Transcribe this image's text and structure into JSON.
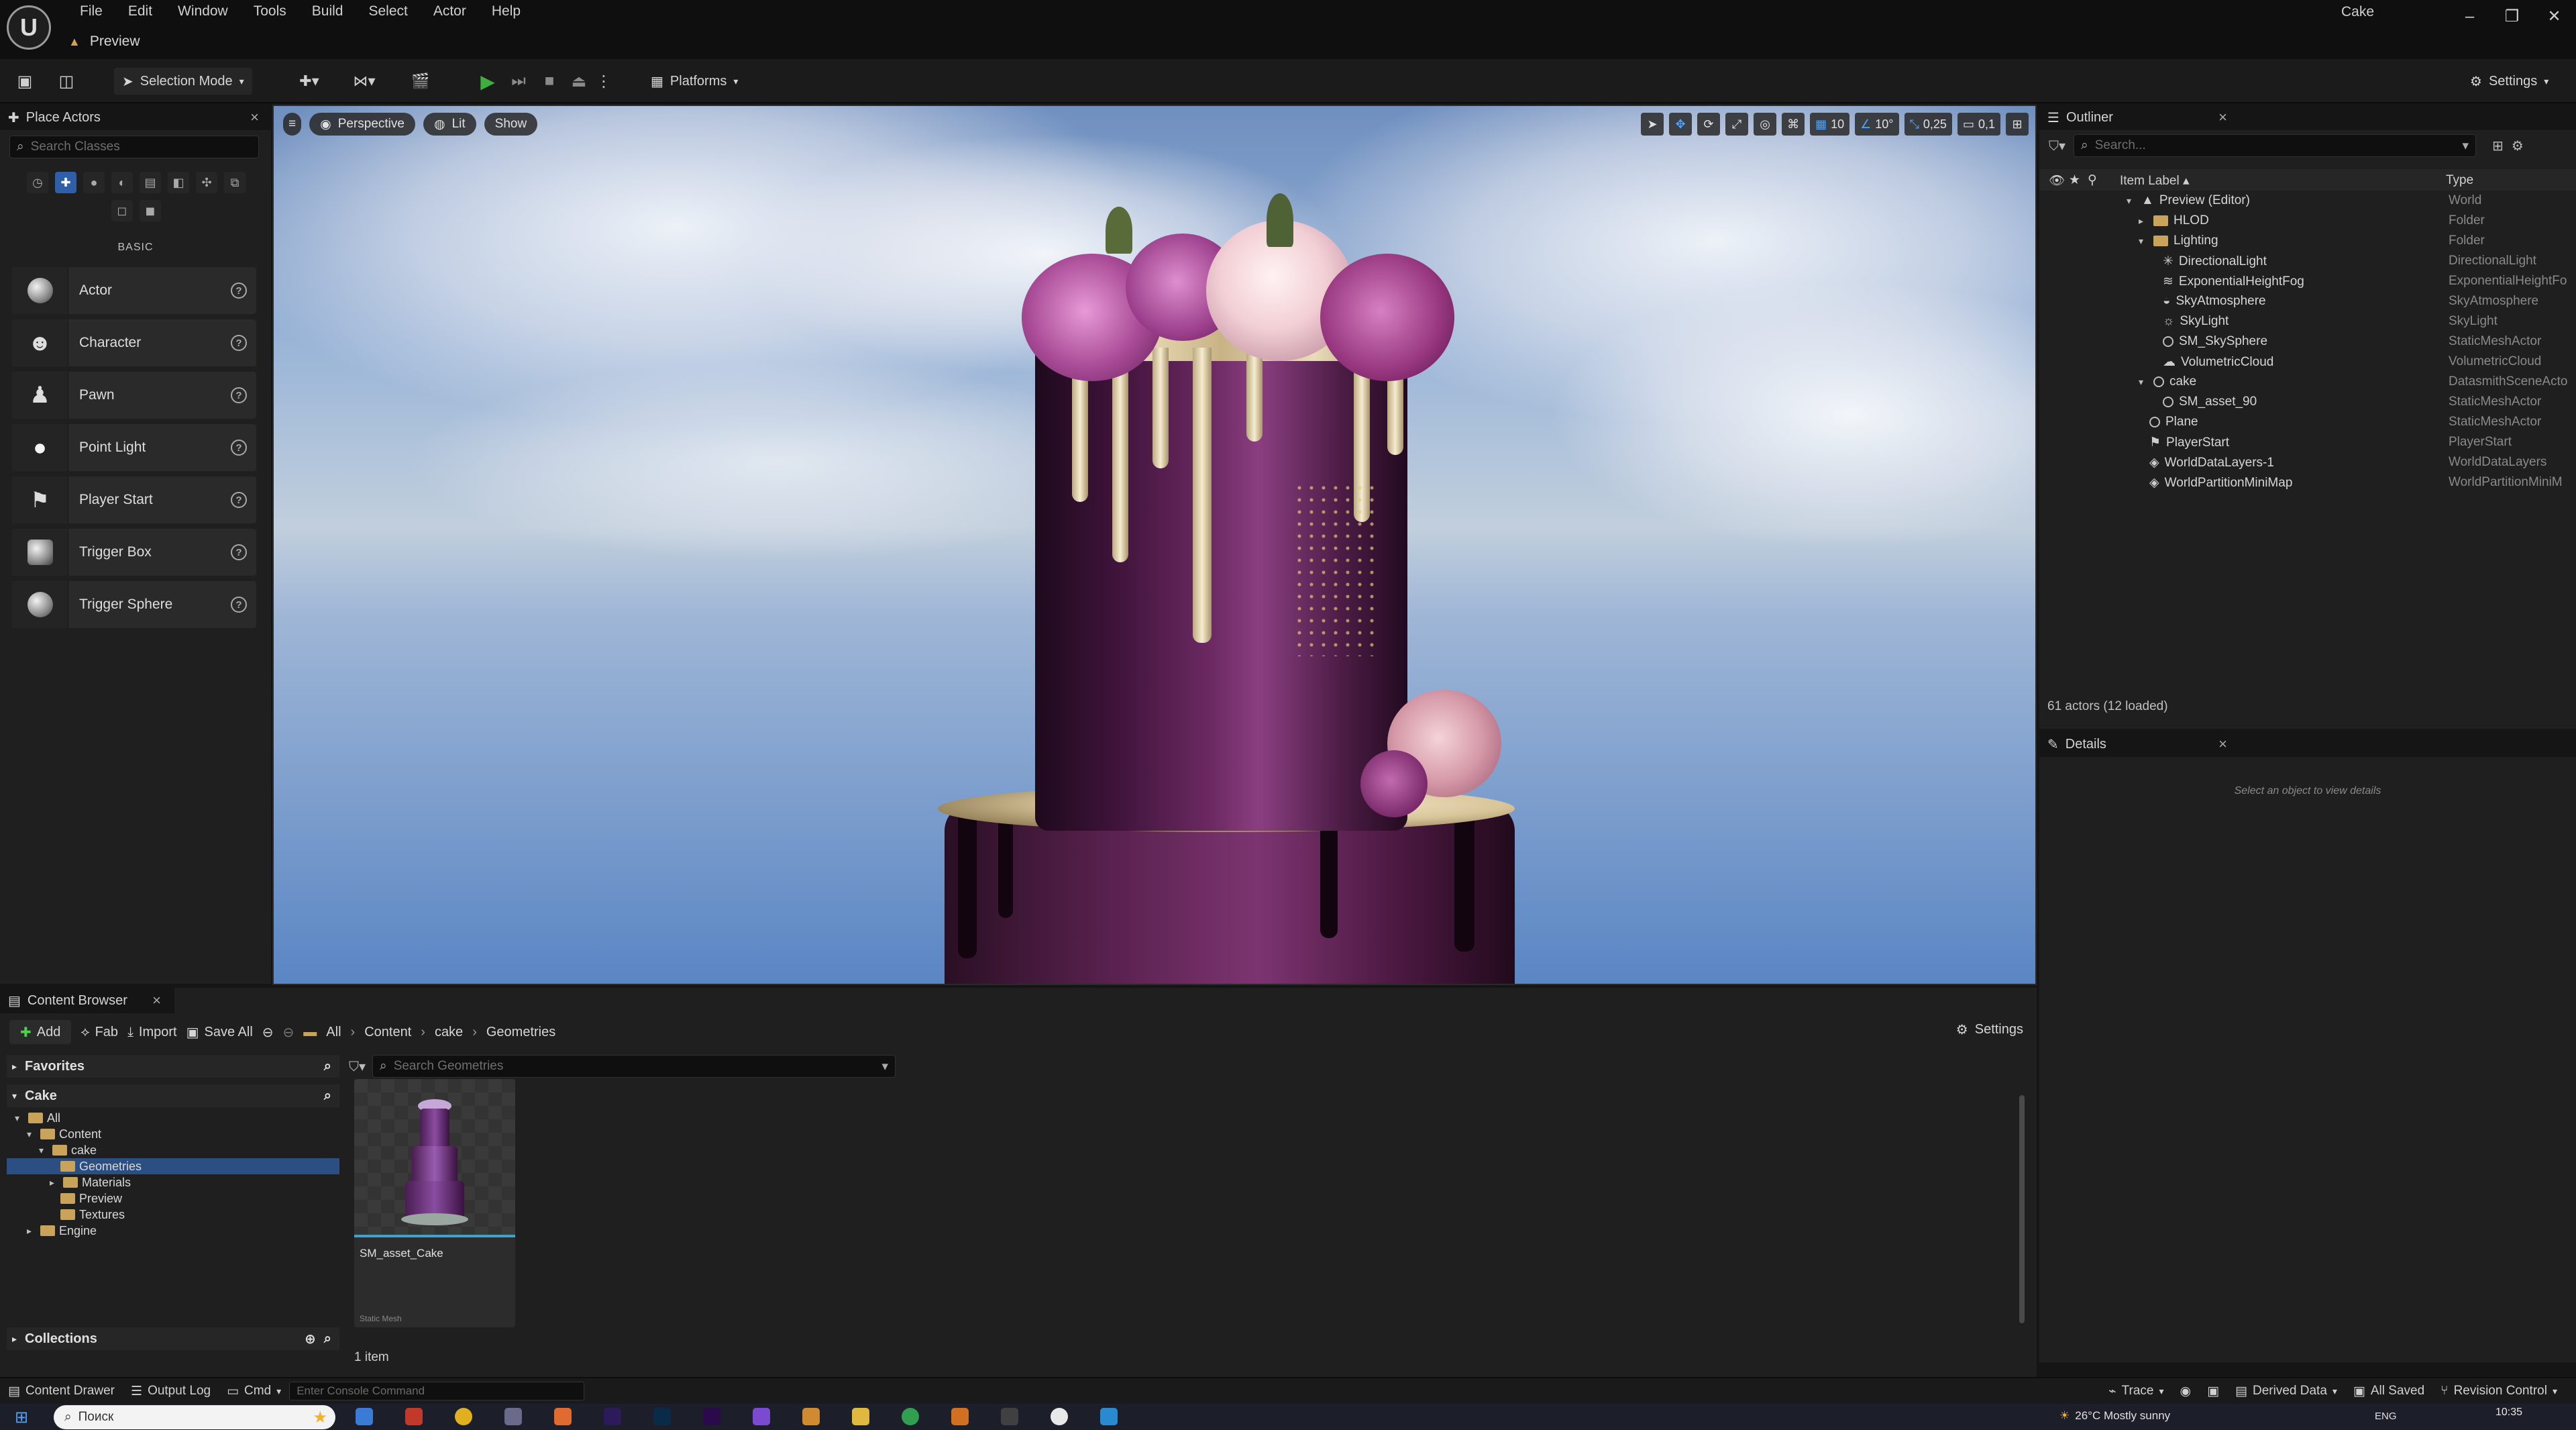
{
  "titlebar": {
    "menu": [
      "File",
      "Edit",
      "Window",
      "Tools",
      "Build",
      "Select",
      "Actor",
      "Help"
    ],
    "level_tab": "Preview",
    "window_title": "Cake",
    "controls": [
      "–",
      "❐",
      "✕"
    ]
  },
  "toolbar": {
    "selection_mode": "Selection Mode",
    "platforms": "Platforms",
    "settings": "Settings"
  },
  "place_actors": {
    "tab": "Place Actors",
    "search_placeholder": "Search Classes",
    "section": "BASIC",
    "items": [
      {
        "label": "Actor"
      },
      {
        "label": "Character"
      },
      {
        "label": "Pawn"
      },
      {
        "label": "Point Light"
      },
      {
        "label": "Player Start"
      },
      {
        "label": "Trigger Box"
      },
      {
        "label": "Trigger Sphere"
      }
    ]
  },
  "viewport": {
    "perspective": "Perspective",
    "lit": "Lit",
    "show": "Show",
    "grid_snap": "10",
    "rotation_snap": "10°",
    "scale_snap": "0,25",
    "camera_speed": "0,1"
  },
  "outliner": {
    "tab": "Outliner",
    "search_placeholder": "Search...",
    "col_label": "Item Label ▴",
    "col_type": "Type",
    "rows": [
      {
        "label": "Preview (Editor)",
        "type": "World"
      },
      {
        "label": "HLOD",
        "type": "Folder"
      },
      {
        "label": "Lighting",
        "type": "Folder"
      },
      {
        "label": "DirectionalLight",
        "type": "DirectionalLight"
      },
      {
        "label": "ExponentialHeightFog",
        "type": "ExponentialHeightFo"
      },
      {
        "label": "SkyAtmosphere",
        "type": "SkyAtmosphere"
      },
      {
        "label": "SkyLight",
        "type": "SkyLight"
      },
      {
        "label": "SM_SkySphere",
        "type": "StaticMeshActor"
      },
      {
        "label": "VolumetricCloud",
        "type": "VolumetricCloud"
      },
      {
        "label": "cake",
        "type": "DatasmithSceneActo"
      },
      {
        "label": "SM_asset_90",
        "type": "StaticMeshActor"
      },
      {
        "label": "Plane",
        "type": "StaticMeshActor"
      },
      {
        "label": "PlayerStart",
        "type": "PlayerStart"
      },
      {
        "label": "WorldDataLayers-1",
        "type": "WorldDataLayers"
      },
      {
        "label": "WorldPartitionMiniMap",
        "type": "WorldPartitionMiniM"
      }
    ],
    "status": "61 actors (12 loaded)"
  },
  "details": {
    "tab": "Details",
    "empty": "Select an object to view details"
  },
  "content_browser": {
    "tab": "Content Browser",
    "add": "Add",
    "fab": "Fab",
    "import": "Import",
    "save_all": "Save All",
    "breadcrumb": [
      "All",
      "Content",
      "cake",
      "Geometries"
    ],
    "settings": "Settings",
    "favorites": "Favorites",
    "project": "Cake",
    "tree": [
      "All",
      "Content",
      "cake",
      "Geometries",
      "Materials",
      "Preview",
      "Textures",
      "Engine"
    ],
    "collections": "Collections",
    "search_placeholder": "Search Geometries",
    "asset_name": "SM_asset_Cake",
    "asset_type": "Static Mesh",
    "count": "1 item"
  },
  "statusbar": {
    "content_drawer": "Content Drawer",
    "output_log": "Output Log",
    "cmd": "Cmd",
    "console_placeholder": "Enter Console Command",
    "trace": "Trace",
    "derived_data": "Derived Data",
    "all_saved": "All Saved",
    "revision_control": "Revision Control"
  },
  "taskbar": {
    "search": "Поиск",
    "weather": "26°C  Mostly sunny",
    "lang": "ENG",
    "time": "10:35"
  },
  "colors": {
    "accent": "#2f5fa8",
    "play": "#3fae3f",
    "folder": "#c9a35a",
    "selection": "#2b4f82"
  }
}
